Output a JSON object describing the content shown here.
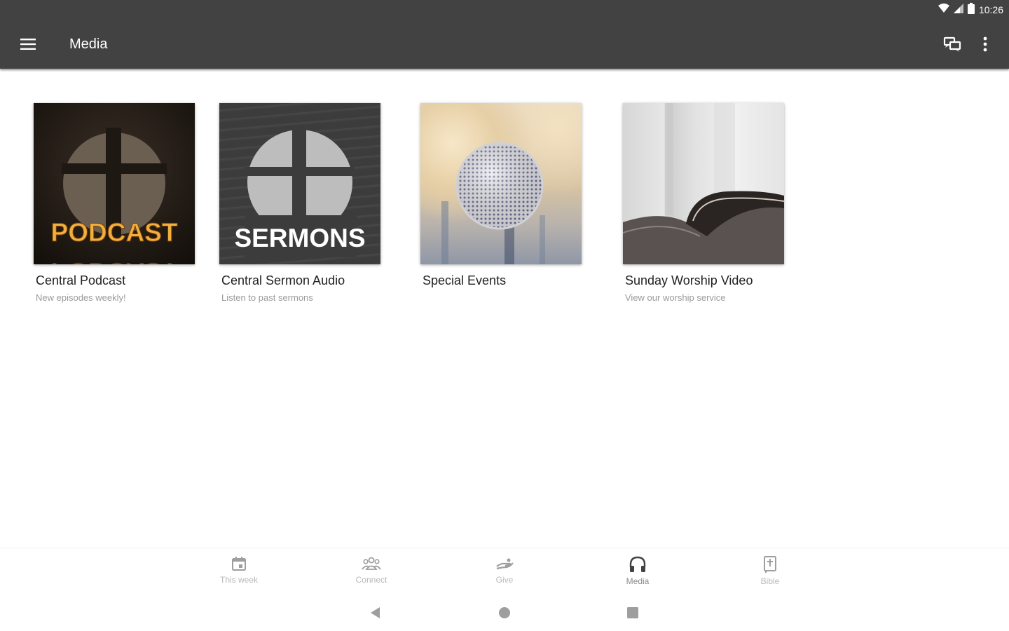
{
  "status_bar": {
    "time": "10:26",
    "icons": [
      "wifi-icon",
      "cell-signal-icon",
      "battery-icon"
    ]
  },
  "app_bar": {
    "title": "Media",
    "menu_icon": "menu-icon",
    "chat_icon": "chat-icon",
    "more_icon": "more-vert-icon",
    "background": "#424242"
  },
  "media_items": [
    {
      "title": "Central Podcast",
      "subtitle": "New episodes weekly!",
      "image_text": "PODCAST",
      "image_reflection": "PODCAST"
    },
    {
      "title": "Central Sermon Audio",
      "subtitle": "Listen to past sermons",
      "image_text": "SERMONS"
    },
    {
      "title": "Special Events",
      "subtitle": ""
    },
    {
      "title": "Sunday Worship Video",
      "subtitle": "View our worship service"
    }
  ],
  "bottom_nav": [
    {
      "label": "This week",
      "icon": "calendar-icon"
    },
    {
      "label": "Connect",
      "icon": "people-icon"
    },
    {
      "label": "Give",
      "icon": "give-hand-icon"
    },
    {
      "label": "Media",
      "icon": "headphones-icon",
      "active": true
    },
    {
      "label": "Bible",
      "icon": "bible-icon"
    }
  ],
  "system_nav": [
    "back-icon",
    "home-icon",
    "recents-icon"
  ]
}
